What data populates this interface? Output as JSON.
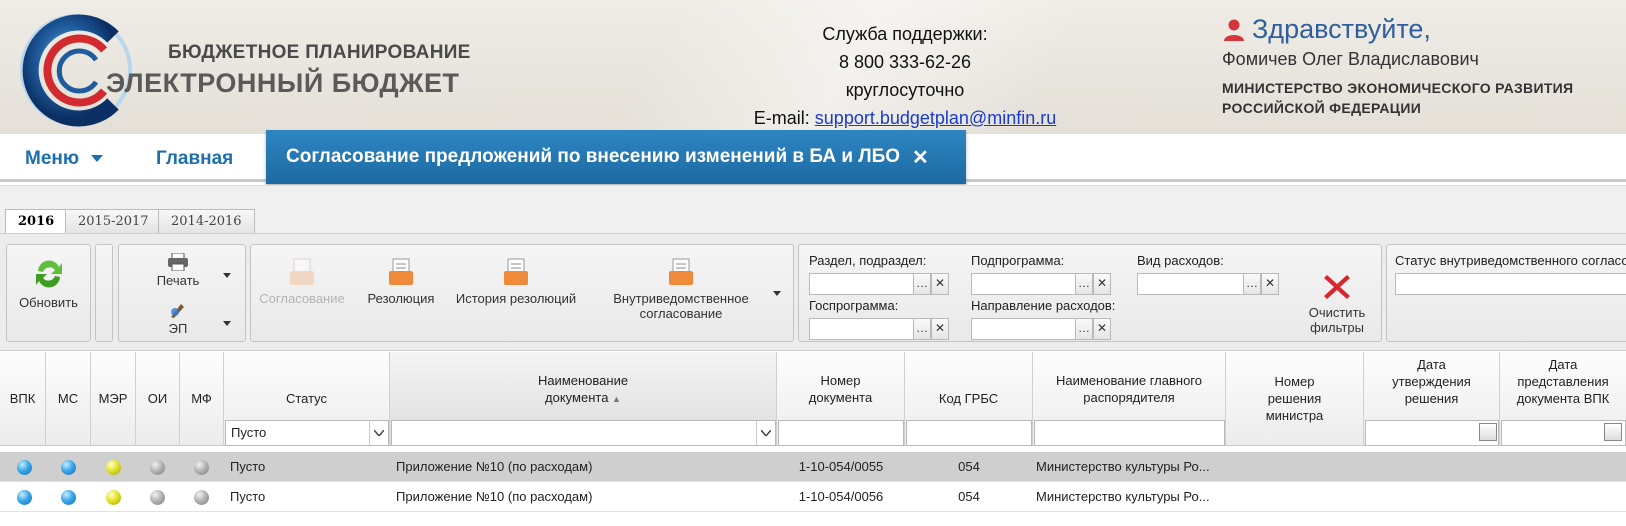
{
  "header": {
    "logo_top": "БЮДЖЕТНОЕ ПЛАНИРОВАНИЕ",
    "logo_bottom": "ЭЛЕКТРОННЫЙ БЮДЖЕТ",
    "support_title": "Служба поддержки:",
    "support_phone": "8 800 333-62-26",
    "support_hours": "круглосуточно",
    "support_email_label": "E-mail:",
    "support_email": "support.budgetplan@minfin.ru",
    "greeting": "Здравствуйте,",
    "user_name": "Фомичев Олег Владиславович",
    "org_line1": "МИНИСТЕРСТВО ЭКОНОМИЧЕСКОГО РАЗВИТИЯ",
    "org_line2": "РОССИЙСКОЙ ФЕДЕРАЦИИ"
  },
  "nav": {
    "menu": "Меню",
    "main": "Главная",
    "active_tab": "Согласование предложений по внесению изменений в БА и ЛБО"
  },
  "year_tabs": [
    "2016",
    "2015-2017",
    "2014-2016"
  ],
  "toolbar": {
    "refresh": "Обновить",
    "print": "Печать",
    "ep": "ЭП",
    "approval": "Согласование",
    "resolution": "Резолюция",
    "resolution_history": "История резолюций",
    "internal_line1": "Внутриведомственное",
    "internal_line2": "согласование",
    "clear_line1": "Очистить",
    "clear_line2": "фильтры"
  },
  "filters": {
    "section": "Раздел, подраздел:",
    "subprogram": "Подпрограмма:",
    "expense_type": "Вид расходов:",
    "state_program": "Госпрограмма:",
    "expense_direction": "Направление расходов:",
    "internal_status": "Статус внутриведомственного согласо"
  },
  "grid": {
    "headers": {
      "vpk": "ВПК",
      "ms": "МС",
      "mer": "МЭР",
      "oi": "ОИ",
      "mf": "МФ",
      "status": "Статус",
      "doc_name_1": "Наименование",
      "doc_name_2": "документа",
      "doc_num_1": "Номер",
      "doc_num_2": "документа",
      "grbs": "Код ГРБС",
      "manager_1": "Наименование главного",
      "manager_2": "распорядителя",
      "decision_1": "Номер",
      "decision_2": "решения",
      "decision_3": "министра",
      "approve_1": "Дата",
      "approve_2": "утверждения",
      "approve_3": "решения",
      "submit_1": "Дата",
      "submit_2": "представления",
      "submit_3": "документа ВПК"
    },
    "status_filter": "Пусто",
    "rows": [
      {
        "dots": [
          "blue",
          "blue",
          "yellow",
          "grey",
          "grey"
        ],
        "status": "Пусто",
        "doc_name": "Приложение №10 (по расходам)",
        "doc_num": "1-10-054/0055",
        "grbs": "054",
        "manager": "Министерство культуры Ро..."
      },
      {
        "dots": [
          "blue",
          "blue",
          "yellow",
          "grey",
          "grey"
        ],
        "status": "Пусто",
        "doc_name": "Приложение №10 (по расходам)",
        "doc_num": "1-10-054/0056",
        "grbs": "054",
        "manager": "Министерство культуры Ро..."
      }
    ]
  },
  "colors": {
    "nav_blue": "#1d6fae",
    "tab_blue": "#2e86c1",
    "greet_blue": "#2f5f9e",
    "clear_red": "#d8262c"
  }
}
